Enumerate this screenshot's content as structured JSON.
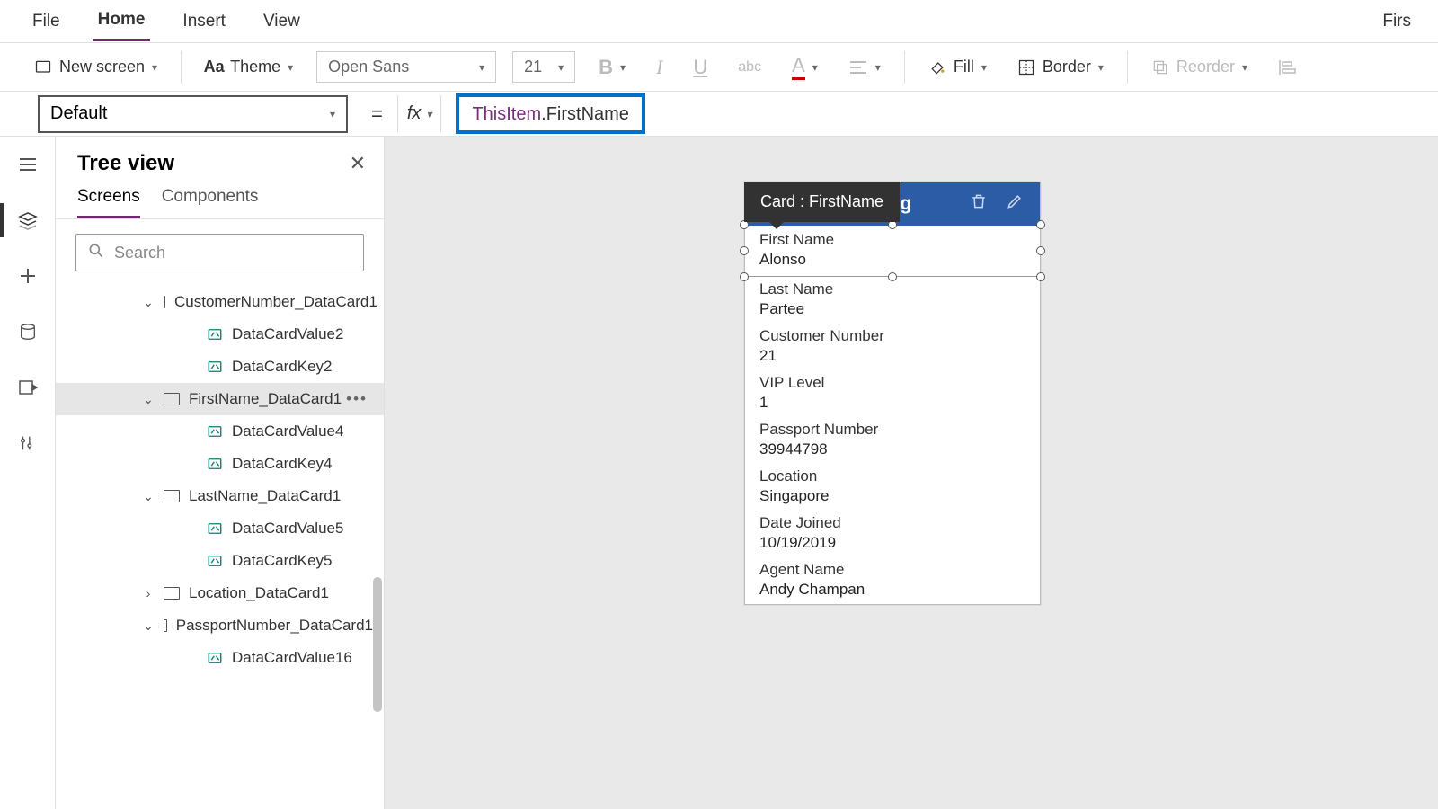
{
  "menubar": {
    "file": "File",
    "home": "Home",
    "insert": "Insert",
    "view": "View",
    "right": "Firs"
  },
  "ribbon": {
    "new_screen": "New screen",
    "theme": "Theme",
    "font": "Open Sans",
    "size": "21",
    "fill": "Fill",
    "border": "Border",
    "reorder": "Reorder"
  },
  "formula_bar": {
    "property": "Default",
    "fx": "fx",
    "expr_obj": "ThisItem",
    "expr_prop": ".FirstName"
  },
  "tree": {
    "title": "Tree view",
    "tab_screens": "Screens",
    "tab_components": "Components",
    "search_placeholder": "Search",
    "items": [
      {
        "label": "CustomerNumber_DataCard1",
        "type": "card",
        "expanded": true,
        "level": 1
      },
      {
        "label": "DataCardValue2",
        "type": "value",
        "level": 2
      },
      {
        "label": "DataCardKey2",
        "type": "value",
        "level": 2
      },
      {
        "label": "FirstName_DataCard1",
        "type": "card",
        "expanded": true,
        "level": 1,
        "selected": true
      },
      {
        "label": "DataCardValue4",
        "type": "value",
        "level": 2
      },
      {
        "label": "DataCardKey4",
        "type": "value",
        "level": 2
      },
      {
        "label": "LastName_DataCard1",
        "type": "card",
        "expanded": true,
        "level": 1
      },
      {
        "label": "DataCardValue5",
        "type": "value",
        "level": 2
      },
      {
        "label": "DataCardKey5",
        "type": "value",
        "level": 2
      },
      {
        "label": "Location_DataCard1",
        "type": "card",
        "expanded": false,
        "level": 1
      },
      {
        "label": "PassportNumber_DataCard1",
        "type": "card",
        "expanded": true,
        "level": 1
      },
      {
        "label": "DataCardValue16",
        "type": "value",
        "level": 2
      }
    ]
  },
  "canvas": {
    "tooltip": "Card : FirstName",
    "header_partial": "ling",
    "fields": [
      {
        "label": "First Name",
        "value": "Alonso",
        "selected": true
      },
      {
        "label": "Last Name",
        "value": "Partee"
      },
      {
        "label": "Customer Number",
        "value": "21"
      },
      {
        "label": "VIP Level",
        "value": "1"
      },
      {
        "label": "Passport Number",
        "value": "39944798"
      },
      {
        "label": "Location",
        "value": "Singapore"
      },
      {
        "label": "Date Joined",
        "value": "10/19/2019"
      },
      {
        "label": "Agent Name",
        "value": "Andy Champan"
      }
    ]
  }
}
